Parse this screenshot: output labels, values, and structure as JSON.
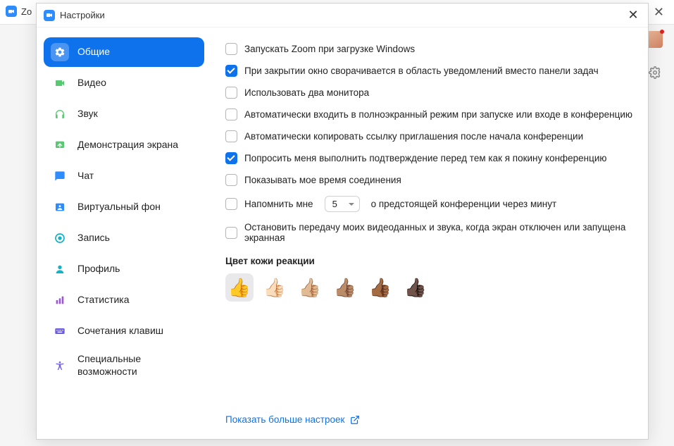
{
  "bg": {
    "title": "Zo"
  },
  "modal": {
    "title": "Настройки"
  },
  "sidebar": {
    "items": [
      {
        "label": "Общие",
        "icon": "gear",
        "color": "#ffffff",
        "active": true
      },
      {
        "label": "Видео",
        "icon": "video",
        "color": "#57c971"
      },
      {
        "label": "Звук",
        "icon": "headphones",
        "color": "#57c971"
      },
      {
        "label": "Демонстрация экрана",
        "icon": "screen",
        "color": "#57c971"
      },
      {
        "label": "Чат",
        "icon": "chat",
        "color": "#2d8cff"
      },
      {
        "label": "Виртуальный фон",
        "icon": "background",
        "color": "#2d8cff"
      },
      {
        "label": "Запись",
        "icon": "record",
        "color": "#10b3c7"
      },
      {
        "label": "Профиль",
        "icon": "profile",
        "color": "#10b3c7"
      },
      {
        "label": "Статистика",
        "icon": "stats",
        "color": "#9b59d0"
      },
      {
        "label": "Сочетания клавиш",
        "icon": "keyboard",
        "color": "#6b5ce0"
      },
      {
        "label": "Специальные возможности",
        "icon": "accessibility",
        "color": "#6b5ce0"
      }
    ]
  },
  "settings": {
    "opt0": {
      "label": "Запускать Zoom при загрузке Windows",
      "checked": false
    },
    "opt1": {
      "label": "При закрытии окно сворачивается в область уведомлений вместо панели задач",
      "checked": true
    },
    "opt2": {
      "label": "Использовать два монитора",
      "checked": false
    },
    "opt3": {
      "label": "Автоматически входить в полноэкранный режим при запуске или входе в конференцию",
      "checked": false
    },
    "opt4": {
      "label": "Автоматически копировать ссылку приглашения после начала конференции",
      "checked": false
    },
    "opt5": {
      "label": "Попросить меня выполнить подтверждение перед тем как я покину конференцию",
      "checked": true
    },
    "opt6": {
      "label": "Показывать мое время соединения",
      "checked": false
    },
    "remind": {
      "before": "Напомнить мне",
      "value": "5",
      "after": "о предстоящей конференции через минут",
      "checked": false
    },
    "opt8": {
      "label": "Остановить передачу моих видеоданных и звука, когда экран отключен или запущена экранная",
      "checked": false
    },
    "skinHeading": "Цвет кожи реакции",
    "skinTones": [
      "👍",
      "👍🏻",
      "👍🏼",
      "👍🏽",
      "👍🏾",
      "👍🏿"
    ],
    "skinSelected": 0
  },
  "footer": {
    "showMore": "Показать больше настроек"
  }
}
